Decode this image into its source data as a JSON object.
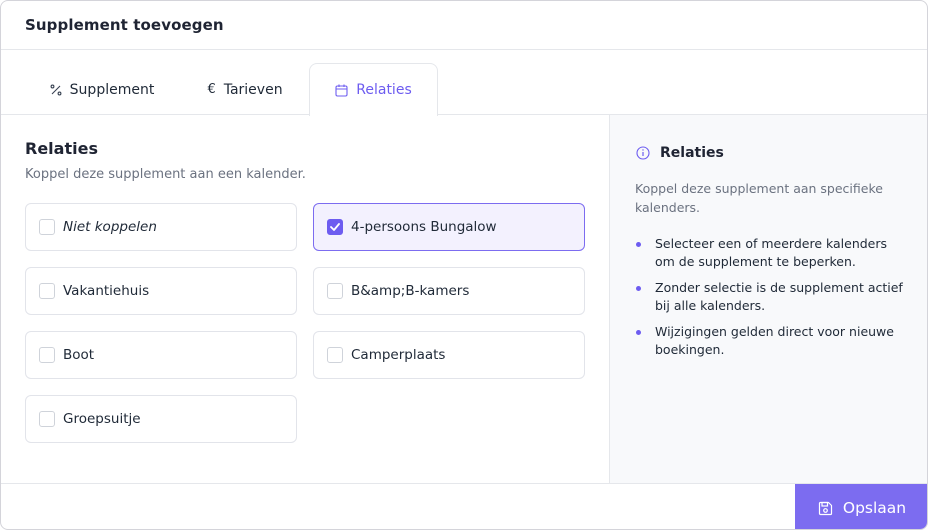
{
  "header": {
    "title": "Supplement toevoegen"
  },
  "tabs": [
    {
      "label": "Supplement",
      "icon": "percent-icon"
    },
    {
      "label": "Tarieven",
      "icon": "euro-icon"
    },
    {
      "label": "Relaties",
      "icon": "calendar-icon",
      "active": true
    }
  ],
  "main": {
    "title": "Relaties",
    "subtitle": "Koppel deze supplement aan een kalender.",
    "options": [
      {
        "label": "Niet koppelen",
        "checked": false
      },
      {
        "label": "4-persoons Bungalow",
        "checked": true
      },
      {
        "label": "Vakantiehuis",
        "checked": false
      },
      {
        "label": "B&amp;B-kamers",
        "checked": false
      },
      {
        "label": "Boot",
        "checked": false
      },
      {
        "label": "Camperplaats",
        "checked": false
      },
      {
        "label": "Groepsuitje",
        "checked": false
      }
    ]
  },
  "info": {
    "icon": "info-icon",
    "title": "Relaties",
    "description": "Koppel deze supplement aan specifieke kalenders.",
    "bullets": [
      "Selecteer een of meerdere kalenders om de supplement te beperken.",
      "Zonder selectie is de supplement actief bij alle kalenders.",
      "Wijzigingen gelden direct voor nieuwe boekingen."
    ]
  },
  "footer": {
    "save_label": "Opslaan",
    "save_icon": "save-icon"
  },
  "colors": {
    "accent": "#7c6cf0",
    "accent_text": "#6d5cf0"
  }
}
